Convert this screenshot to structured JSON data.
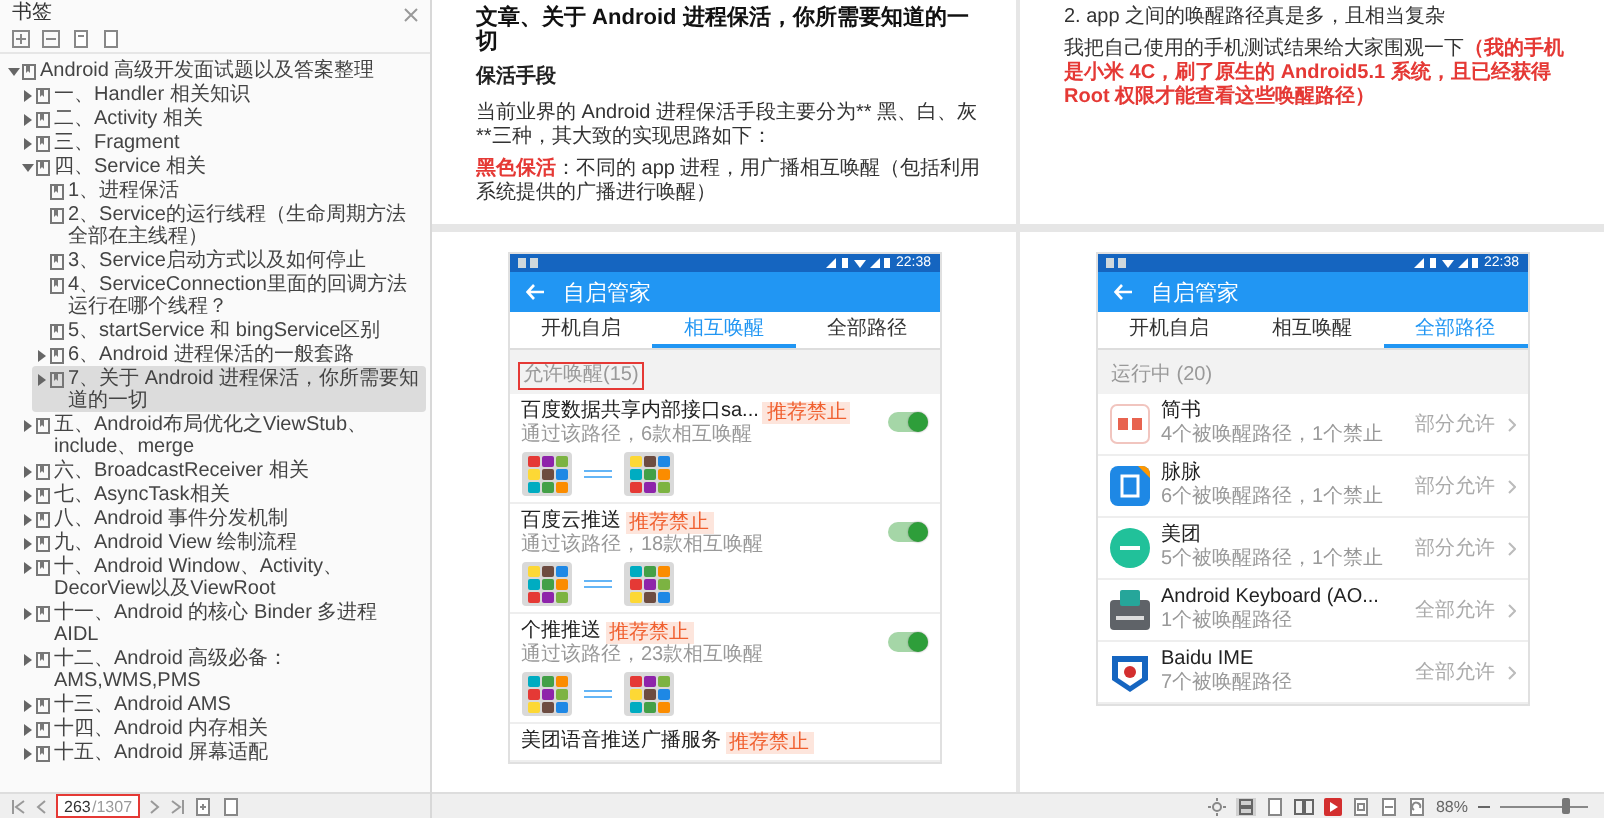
{
  "sidebar": {
    "title": "书签",
    "tree": [
      {
        "label": "Android 高级开发面试题以及答案整理",
        "kind": "branch",
        "expanded": true,
        "selected": false,
        "children": [
          {
            "label": "一、Handler 相关知识",
            "kind": "branch",
            "expanded": false,
            "selected": false
          },
          {
            "label": "二、Activity 相关",
            "kind": "branch",
            "expanded": false,
            "selected": false
          },
          {
            "label": "三、Fragment",
            "kind": "branch",
            "expanded": false,
            "selected": false
          },
          {
            "label": "四、Service 相关",
            "kind": "branch",
            "expanded": true,
            "selected": false,
            "children": [
              {
                "label": "1、进程保活",
                "kind": "leaf",
                "selected": false
              },
              {
                "label": "2、Service的运行线程（生命周期方法全部在主线程）",
                "kind": "leaf",
                "selected": false
              },
              {
                "label": "3、Service启动方式以及如何停止",
                "kind": "leaf",
                "selected": false
              },
              {
                "label": "4、ServiceConnection里面的回调方法运行在哪个线程？",
                "kind": "leaf",
                "selected": false
              },
              {
                "label": "5、startService 和 bingService区别",
                "kind": "leaf",
                "selected": false
              },
              {
                "label": "6、Android 进程保活的一般套路",
                "kind": "branch",
                "expanded": false,
                "selected": false
              },
              {
                "label": "7、关于 Android 进程保活，你所需要知道的一切",
                "kind": "branch",
                "expanded": false,
                "selected": true
              }
            ]
          },
          {
            "label": "五、Android布局优化之ViewStub、include、merge",
            "kind": "branch",
            "expanded": false,
            "selected": false
          },
          {
            "label": "六、BroadcastReceiver 相关",
            "kind": "branch",
            "expanded": false,
            "selected": false
          },
          {
            "label": "七、AsyncTask相关",
            "kind": "branch",
            "expanded": false,
            "selected": false
          },
          {
            "label": "八、Android 事件分发机制",
            "kind": "branch",
            "expanded": false,
            "selected": false
          },
          {
            "label": "九、Android View 绘制流程",
            "kind": "branch",
            "expanded": false,
            "selected": false
          },
          {
            "label": "十、Android Window、Activity、DecorView以及ViewRoot",
            "kind": "branch",
            "expanded": false,
            "selected": false
          },
          {
            "label": "十一、Android 的核心 Binder 多进程 AIDL",
            "kind": "branch",
            "expanded": false,
            "selected": false
          },
          {
            "label": "十二、Android 高级必备：AMS,WMS,PMS",
            "kind": "branch",
            "expanded": false,
            "selected": false
          },
          {
            "label": "十三、Android AMS",
            "kind": "branch",
            "expanded": false,
            "selected": false
          },
          {
            "label": "十四、Android 内存相关",
            "kind": "branch",
            "expanded": false,
            "selected": false
          },
          {
            "label": "十五、Android 屏幕适配",
            "kind": "branch",
            "expanded": false,
            "selected": false
          }
        ]
      }
    ]
  },
  "pager": {
    "page": "263",
    "total": "/1307",
    "highlighted": true
  },
  "pages_top": [
    {
      "title": "文章、关于 Android 进程保活，你所需要知道的一切",
      "heading": "保活手段",
      "paragraphs": [
        {
          "kind": "plain",
          "text": "当前业界的 Android 进程保活手段主要分为** 黑、白、灰 **三种，其大致的实现思路如下："
        },
        {
          "kind": "rich",
          "text": "**黑色保活**：不同的 app 进程，用广播相互唤醒（包括利用系统提供的广播进行唤醒）"
        }
      ]
    },
    {
      "paragraphs": [
        {
          "kind": "plain",
          "text": "2. app 之间的唤醒路径真是多，且相当复杂"
        },
        {
          "kind": "rich",
          "text": "我把自己使用的手机测试结果给大家围观一下**（我的手机是小米 4C，刷了原生的 Android5.1 系统，且已经获得 Root 权限才能查看这些唤醒路径）**"
        }
      ]
    }
  ],
  "phones": [
    {
      "kind": "wake",
      "time": "22:38",
      "title": "自启管家",
      "tabs": [
        {
          "label": "开机自启",
          "selected": false
        },
        {
          "label": "相互唤醒",
          "selected": true
        },
        {
          "label": "全部路径",
          "selected": false
        }
      ],
      "section": {
        "label": "允许唤醒(15)",
        "highlighted": true
      },
      "items": [
        {
          "name": "百度数据共享内部接口sa...",
          "badge": "推荐禁止",
          "detail": "通过该路径，6款相互唤醒",
          "on": true
        },
        {
          "name": "百度云推送",
          "badge": "推荐禁止",
          "detail": "通过该路径，18款相互唤醒",
          "on": true
        },
        {
          "name": "个推推送",
          "badge": "推荐禁止",
          "detail": "通过该路径，23款相互唤醒",
          "on": true
        },
        {
          "name": "美团语音推送广播服务",
          "badge": "推荐禁止"
        }
      ]
    },
    {
      "kind": "paths",
      "time": "22:38",
      "title": "自启管家",
      "tabs": [
        {
          "label": "开机自启",
          "selected": false
        },
        {
          "label": "相互唤醒",
          "selected": false
        },
        {
          "label": "全部路径",
          "selected": true
        }
      ],
      "section": {
        "label": "运行中 (20)",
        "highlighted": false
      },
      "items": [
        {
          "name": "简书",
          "detail": "4个被唤醒路径，1个禁止",
          "status": "部分允许"
        },
        {
          "name": "脉脉",
          "detail": "6个被唤醒路径，1个禁止",
          "status": "部分允许"
        },
        {
          "name": "美团",
          "detail": "5个被唤醒路径，1个禁止",
          "status": "部分允许"
        },
        {
          "name": "Android Keyboard (AO...",
          "detail": "1个被唤醒路径",
          "status": "全部允许"
        },
        {
          "name": "Baidu IME",
          "detail": "7个被唤醒路径",
          "status": "全部允许"
        }
      ]
    }
  ],
  "status_bar": {
    "zoom": "88%",
    "level": 0.75
  }
}
